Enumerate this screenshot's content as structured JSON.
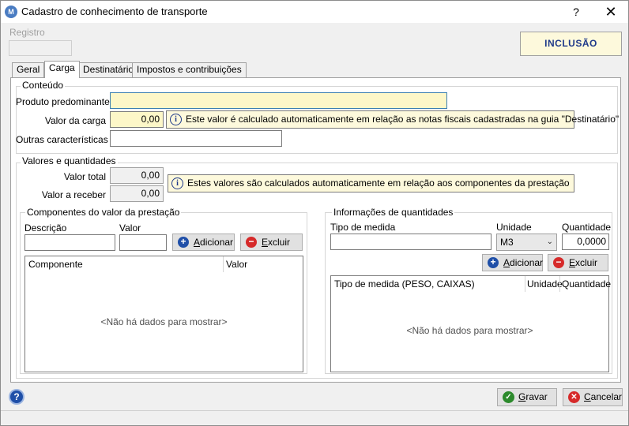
{
  "window": {
    "title": "Cadastro de conhecimento de transporte",
    "help_glyph": "?",
    "close_glyph": "✕",
    "app_icon_glyph": "M"
  },
  "header": {
    "registro_label": "Registro",
    "registro_value": "",
    "mode_badge": "INCLUSÃO"
  },
  "tabs": [
    {
      "label": "Geral",
      "active": false
    },
    {
      "label": "Carga",
      "active": true
    },
    {
      "label": "Destinatário",
      "active": false
    },
    {
      "label": "Impostos e contribuições",
      "active": false
    }
  ],
  "conteudo": {
    "group_title": "Conteúdo",
    "produto_label": "Produto predominante",
    "produto_value": "",
    "valor_label": "Valor da carga",
    "valor_value": "0,00",
    "valor_info": "Este valor é calculado automaticamente em relação as notas fiscais cadastradas na guia \"Destinatário\"",
    "outras_label": "Outras características",
    "outras_value": ""
  },
  "valores": {
    "group_title": "Valores e quantidades",
    "total_label": "Valor total",
    "total_value": "0,00",
    "receber_label": "Valor a receber",
    "receber_value": "0,00",
    "info": "Estes valores são calculados automaticamente em relação aos componentes da prestação"
  },
  "componentes": {
    "group_title": "Componentes do valor da prestação",
    "descricao_label": "Descrição",
    "descricao_value": "",
    "valor_label": "Valor",
    "valor_value": "",
    "add_prefix": "A",
    "add_rest": "dicionar",
    "del_prefix": "E",
    "del_rest": "xcluir",
    "columns": [
      "Componente",
      "Valor"
    ],
    "empty_text": "<Não há dados para mostrar>"
  },
  "quantidades": {
    "group_title": "Informações de quantidades",
    "tipo_label": "Tipo de medida",
    "tipo_value": "",
    "unidade_label": "Unidade",
    "unidade_value": "M3",
    "quantidade_label": "Quantidade",
    "quantidade_value": "0,0000",
    "add_prefix": "A",
    "add_rest": "dicionar",
    "del_prefix": "E",
    "del_rest": "xcluir",
    "columns": [
      "Tipo de medida (PESO, CAIXAS)",
      "Unidade",
      "Quantidade"
    ],
    "empty_text": "<Não há dados para mostrar>"
  },
  "footer": {
    "help_glyph": "?",
    "save_prefix": "G",
    "save_rest": "ravar",
    "cancel_prefix": "C",
    "cancel_rest": "ancelar"
  },
  "colors": {
    "mode_badge_text": "#1f3a8a",
    "yellow_field": "#fdf7c8",
    "info_box": "#fdf9dc"
  }
}
